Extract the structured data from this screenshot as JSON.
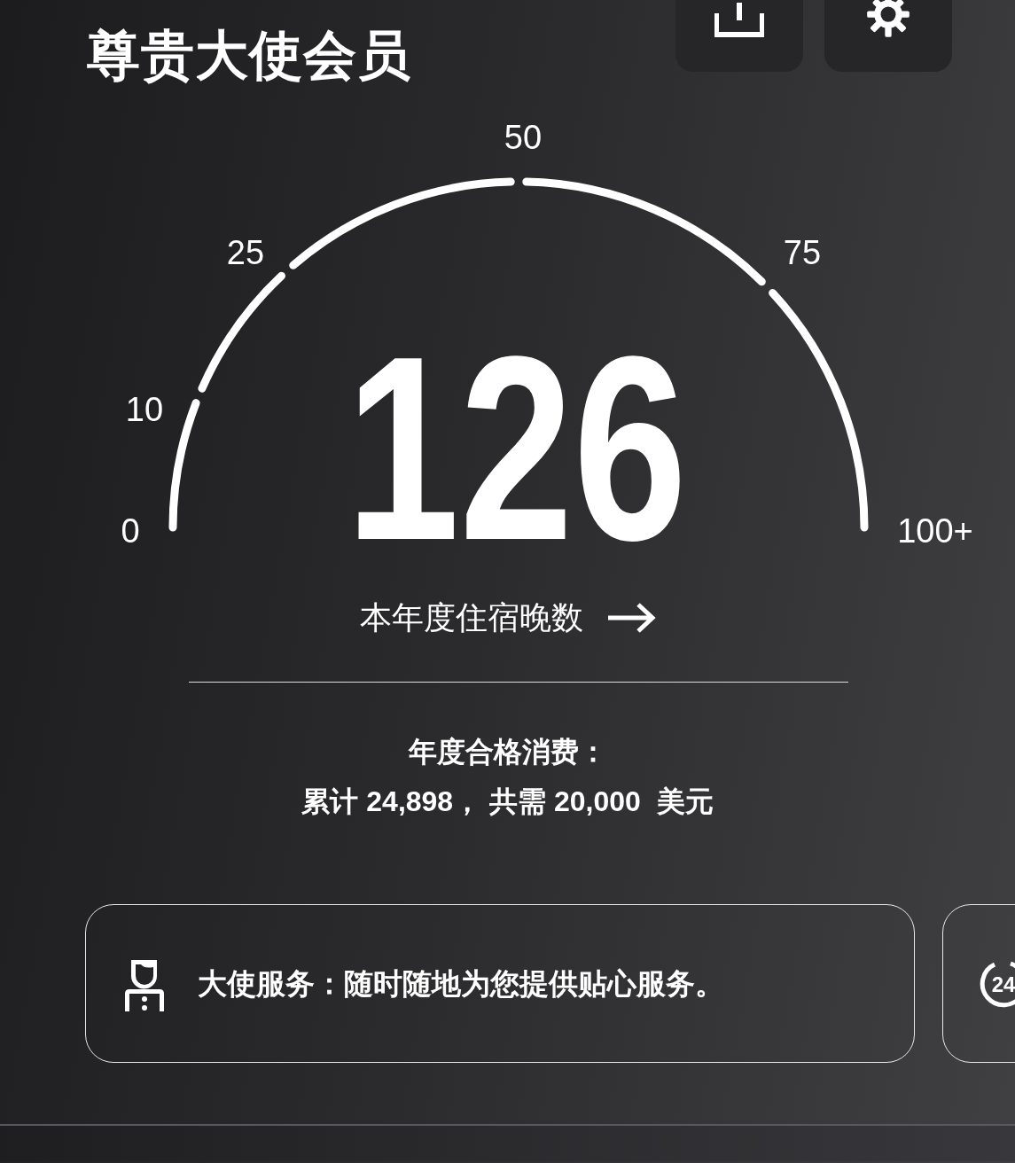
{
  "header": {
    "title": "尊贵大使会员",
    "buttons": [
      {
        "kind": "share"
      },
      {
        "kind": "settings"
      }
    ]
  },
  "gauge": {
    "ticks": [
      "0",
      "10",
      "25",
      "50",
      "75",
      "100+"
    ],
    "value": "126",
    "caption": "本年度住宿晚数"
  },
  "spending": {
    "label": "年度合格消费：",
    "summary": "累计 24,898， 共需 20,000  美元"
  },
  "cards": [
    {
      "kind": "person",
      "text": "大使服务：随时随地为您提供贴心服务。"
    },
    {
      "kind": "clock",
      "icon_text": "24"
    }
  ]
}
